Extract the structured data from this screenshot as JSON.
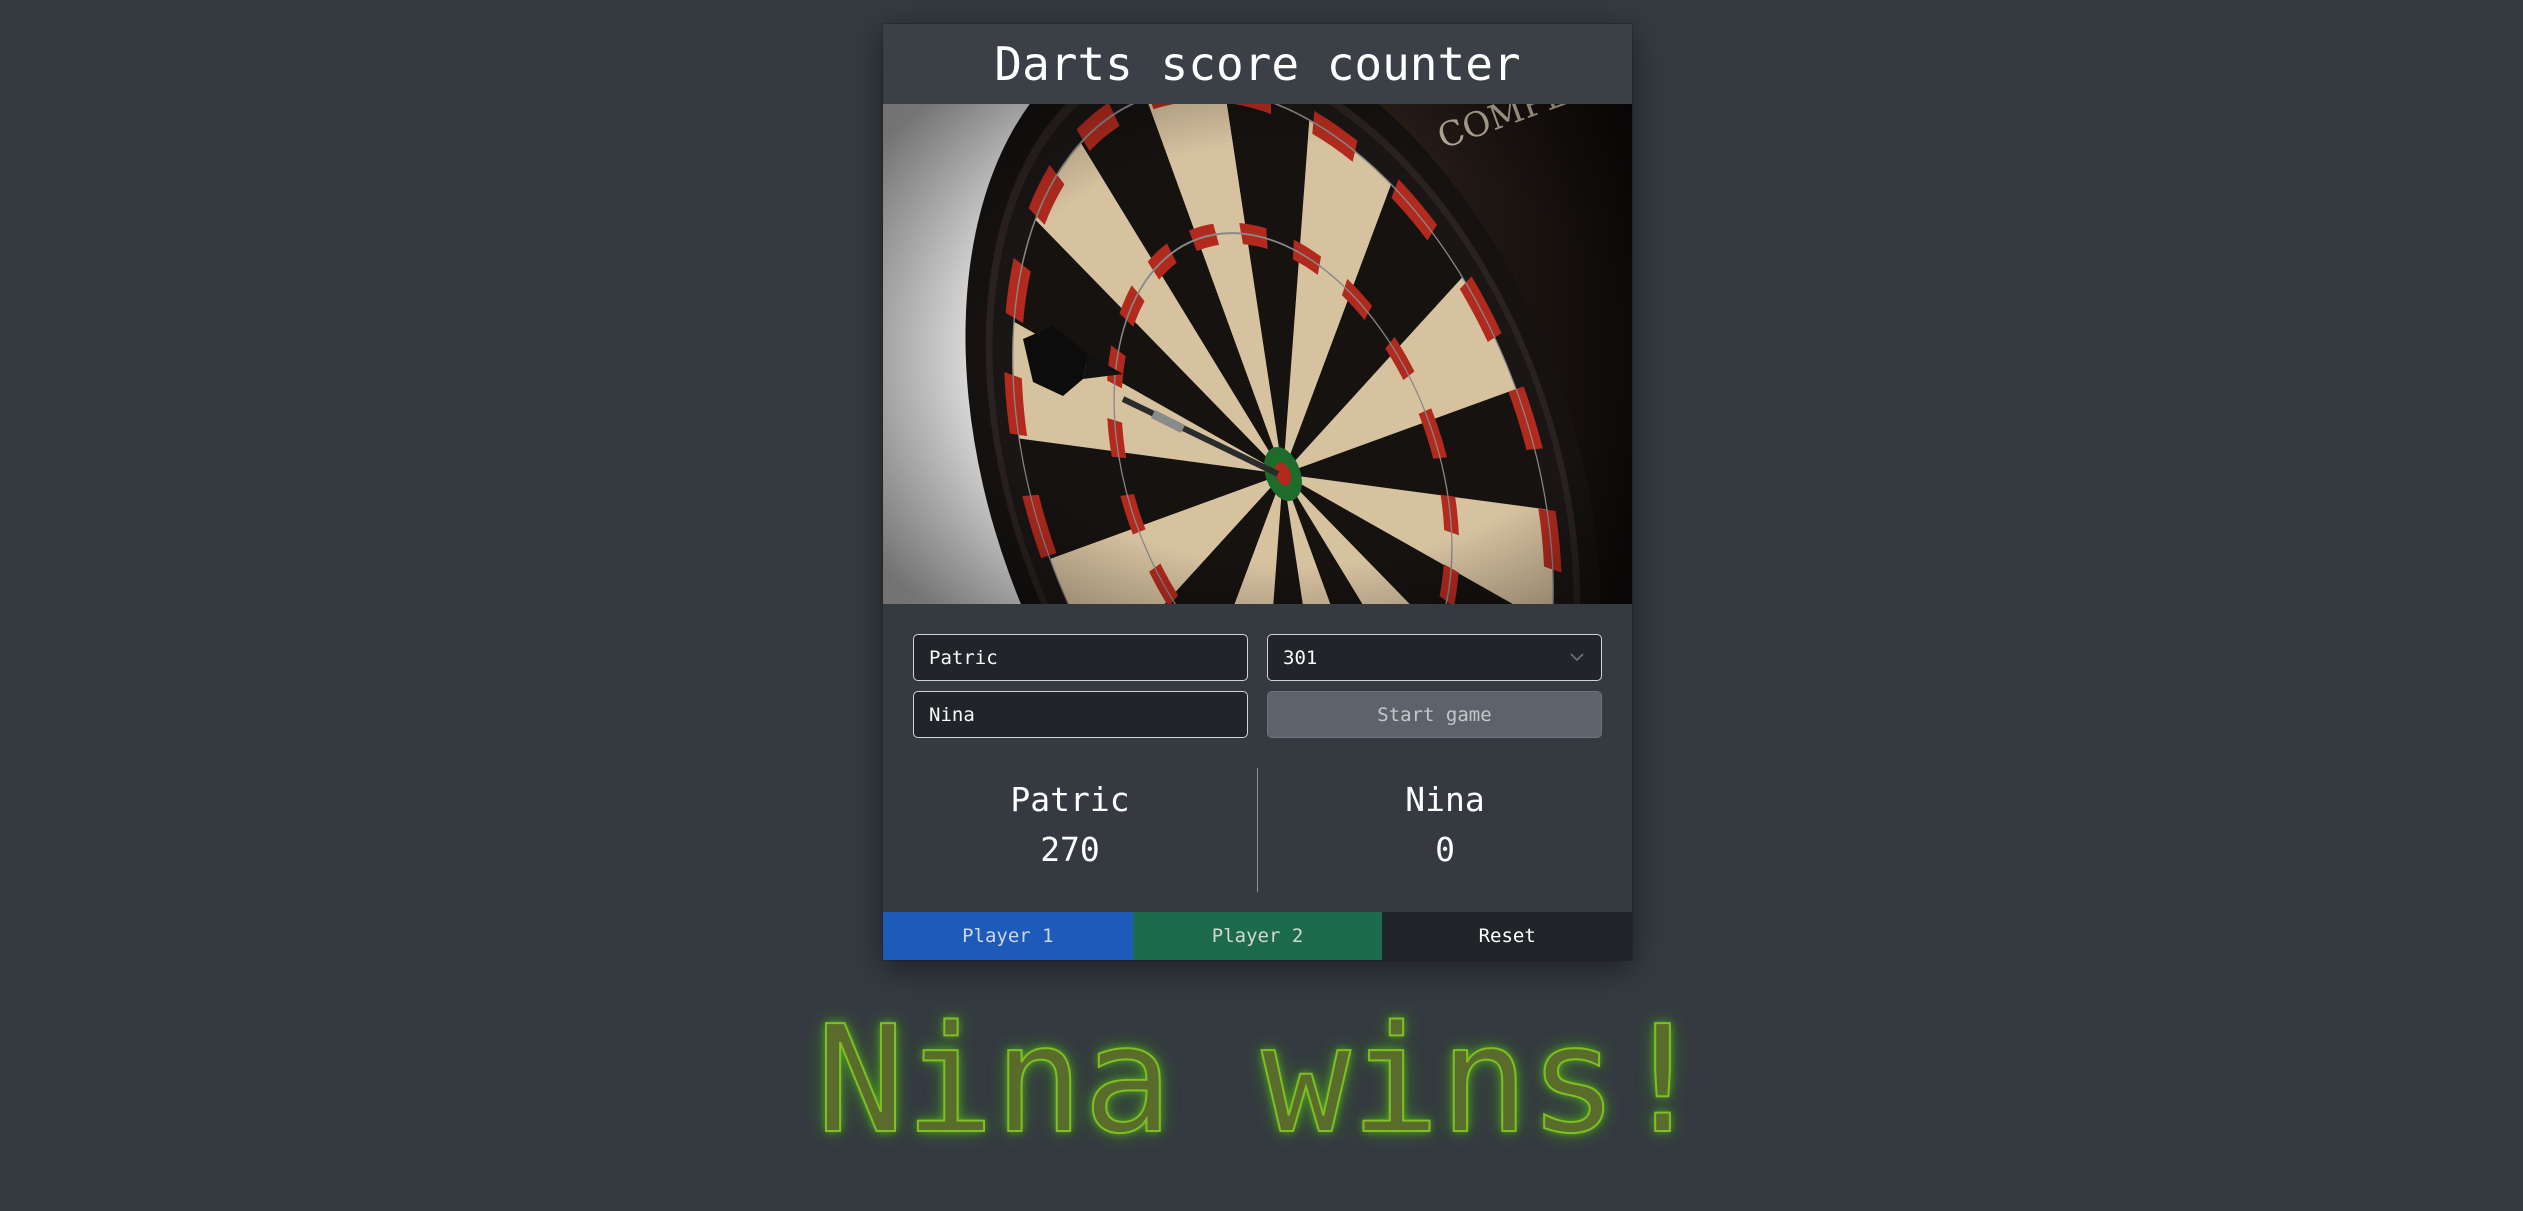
{
  "header": {
    "title": "Darts score counter"
  },
  "hero": {
    "image_icon": "dartboard-photo",
    "board_label": "COMPETITION"
  },
  "form": {
    "player1_value": "Patric",
    "player2_value": "Nina",
    "game_type_value": "301",
    "start_label": "Start game"
  },
  "scores": {
    "player1": {
      "name": "Patric",
      "points": "270"
    },
    "player2": {
      "name": "Nina",
      "points": "0"
    }
  },
  "buttons": {
    "player1_label": "Player 1",
    "player2_label": "Player 2",
    "reset_label": "Reset"
  },
  "result": {
    "winner_text": "Nina wins!"
  },
  "colors": {
    "background": "#343a40",
    "player1": "#1c5bb9",
    "player2": "#1d6b4d",
    "reset": "#212529",
    "winner_glow": "#7fbf1f"
  }
}
